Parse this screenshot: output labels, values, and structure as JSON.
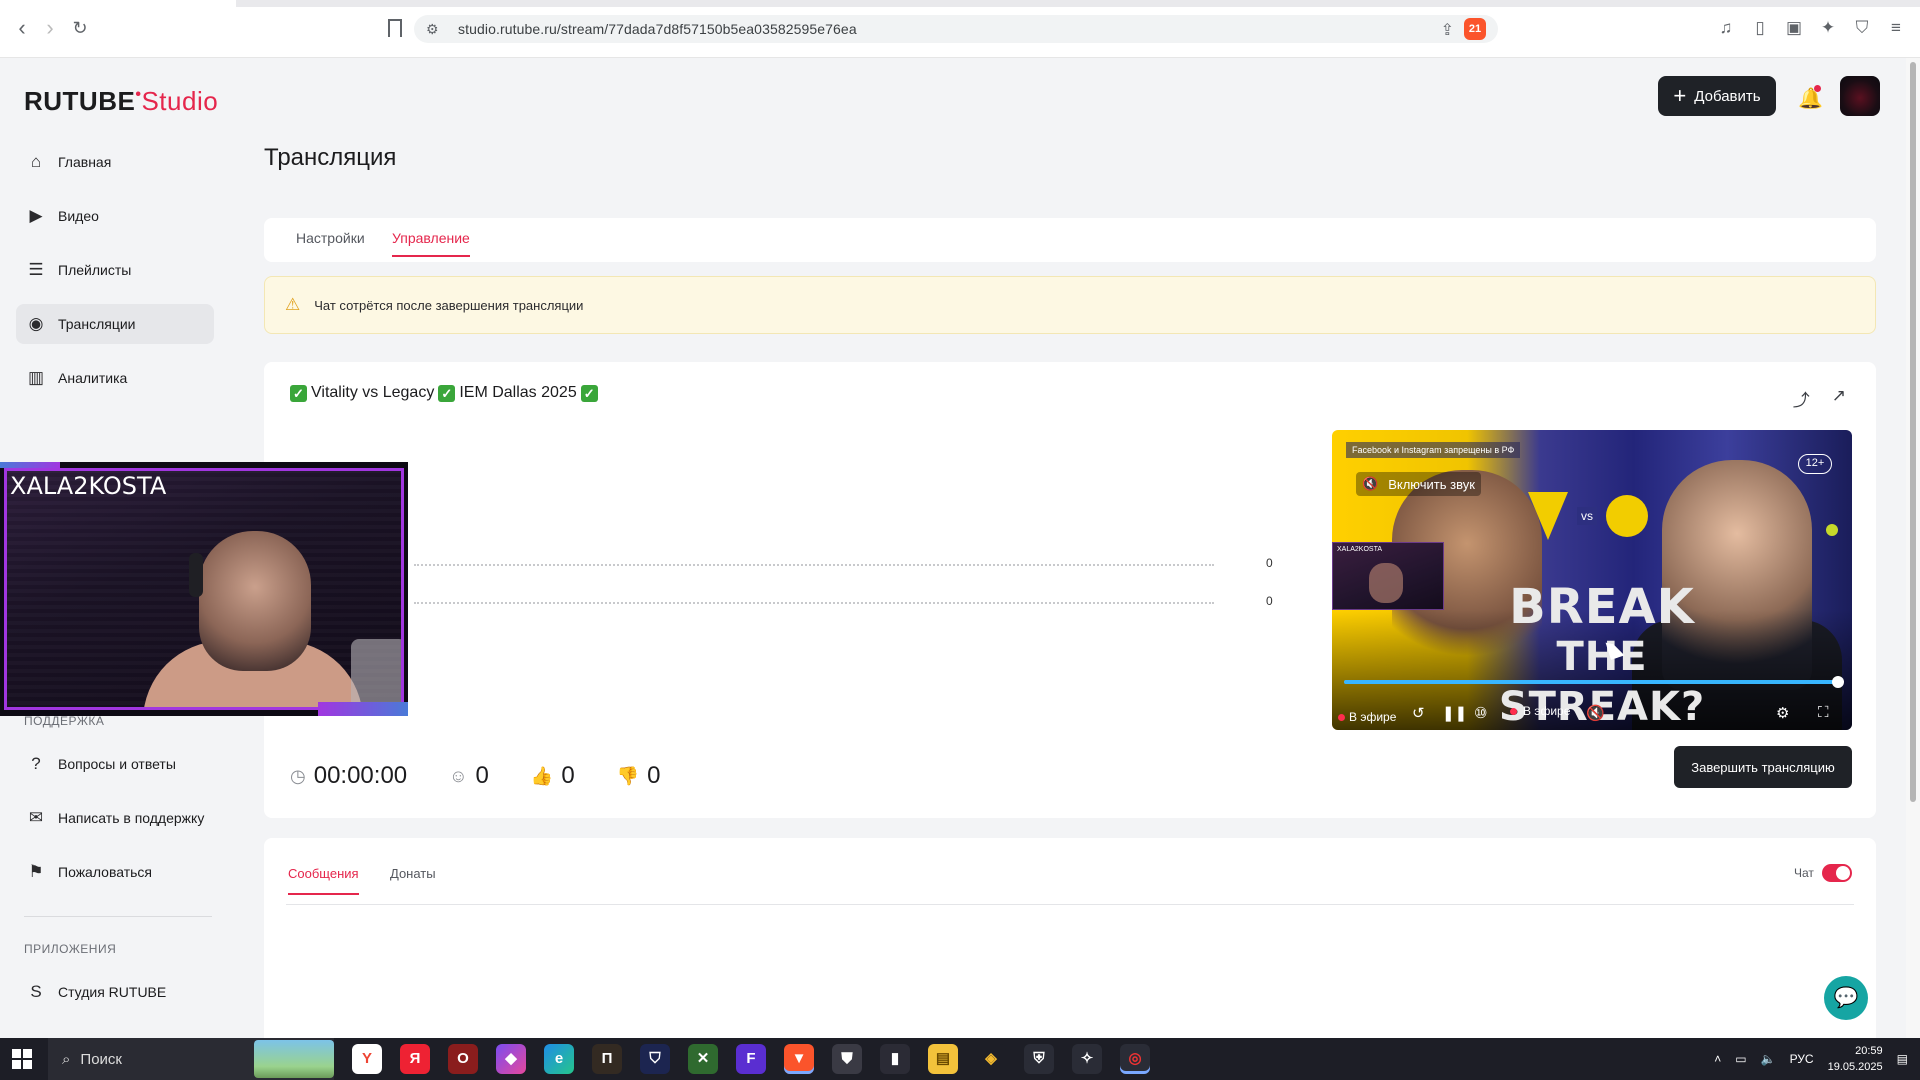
{
  "browser": {
    "url": "studio.rutube.ru/stream/77dada7d8f57150b5ea03582595e76ea",
    "shield_badge": "21"
  },
  "header": {
    "logo_main": "RUTUBE",
    "logo_sub": "Studio",
    "add_button": "Добавить"
  },
  "sidebar": {
    "items": [
      {
        "label": "Главная",
        "icon": "home-icon"
      },
      {
        "label": "Видео",
        "icon": "video-icon"
      },
      {
        "label": "Плейлисты",
        "icon": "list-icon"
      },
      {
        "label": "Трансляции",
        "icon": "broadcast-icon"
      },
      {
        "label": "Аналитика",
        "icon": "analytics-icon"
      }
    ],
    "support_heading": "ПОДДЕРЖКА",
    "support_items": [
      {
        "label": "Вопросы и ответы",
        "icon": "help-icon"
      },
      {
        "label": "Написать в поддержку",
        "icon": "mail-icon"
      },
      {
        "label": "Пожаловаться",
        "icon": "flag-icon"
      }
    ],
    "apps_heading": "ПРИЛОЖЕНИЯ",
    "apps_items": [
      {
        "label": "Студия RUTUBE",
        "icon": "studio-app-icon"
      }
    ]
  },
  "main": {
    "title": "Трансляция",
    "tabs": [
      {
        "label": "Настройки",
        "active": false
      },
      {
        "label": "Управление",
        "active": true
      }
    ],
    "alert": "Чат сотрётся после завершения трансляции",
    "stream": {
      "title_part1": "Vitality vs Legacy",
      "title_part2": "IEM Dallas 2025",
      "chart_values": [
        "0",
        "0"
      ],
      "stats": {
        "duration": "00:00:00",
        "viewers": "0",
        "likes": "0",
        "dislikes": "0"
      },
      "end_button": "Завершить трансляцию"
    },
    "player": {
      "banner": "Facebook и Instagram запрещены в РФ",
      "unmute": "Включить звук",
      "age": "12+",
      "headline_1": "BREAK",
      "headline_2": "THE STREAK?",
      "live_label": "В эфире",
      "live_label_2": "В эфире",
      "pip_label": "XALA2KOSTA",
      "progress": 0.99
    },
    "chat": {
      "tabs": [
        {
          "label": "Сообщения",
          "active": true
        },
        {
          "label": "Донаты",
          "active": false
        }
      ],
      "toggle_label": "Чат",
      "toggle_on": true
    }
  },
  "webcam": {
    "name": "XALA2KOSTA"
  },
  "taskbar": {
    "search_label": "Поиск",
    "lang": "РУС",
    "time": "20:59",
    "date": "19.05.2025"
  }
}
